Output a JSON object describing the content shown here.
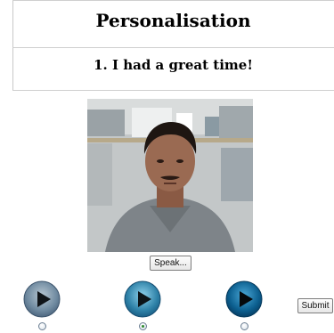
{
  "header": {
    "title": "Personalisation"
  },
  "question": {
    "text": "1. I had a great time!"
  },
  "actions": {
    "speak_label": "Speak...",
    "submit_label": "Submit"
  },
  "options": {
    "selected_index": 1,
    "items": [
      {
        "icon": "play-icon",
        "color": "#6f8aa0"
      },
      {
        "icon": "play-icon",
        "color": "#2f82a8"
      },
      {
        "icon": "play-icon",
        "color": "#0c5f8f"
      }
    ]
  }
}
